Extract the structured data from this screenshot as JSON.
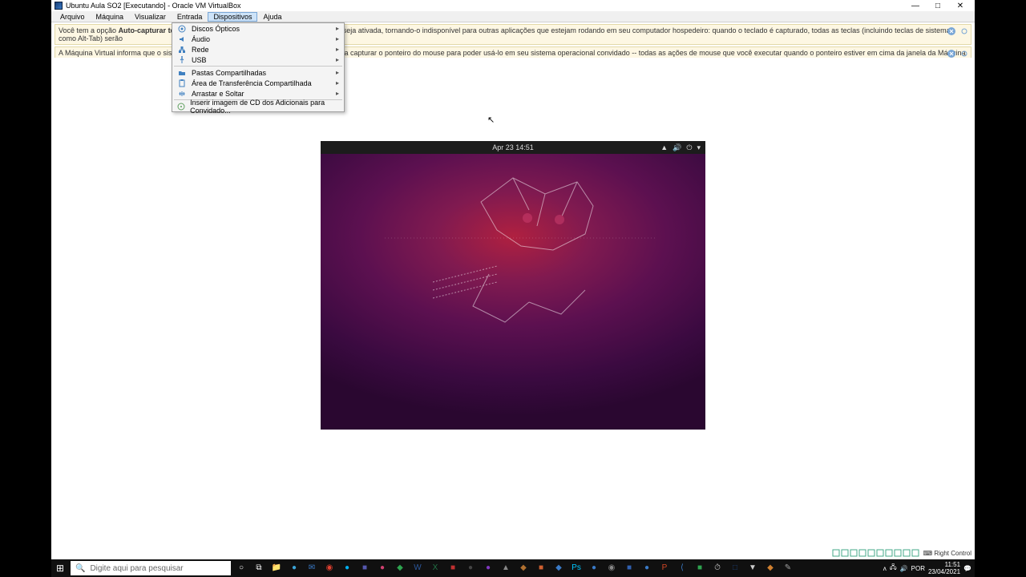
{
  "window": {
    "title": "Ubuntu Aula SO2 [Executando] - Oracle VM VirtualBox",
    "min": "—",
    "max": "□",
    "close": "✕"
  },
  "menubar": {
    "items": [
      "Arquivo",
      "Máquina",
      "Visualizar",
      "Entrada",
      "Dispositivos",
      "Ajuda"
    ],
    "active_index": 4
  },
  "info1": {
    "pre": "Você tem a opção ",
    "bold": "Auto-capturar teclado",
    "post": " ligada todas as vezes em que a janela da MV seja ativada, tornando-o indisponível para outras aplicações que estejam rodando em seu computador hospedeiro: quando o teclado é capturado, todas as teclas (incluindo teclas de sistema como Alt-Tab) serão"
  },
  "info2": {
    "text": "A Máquina Virtual informa que o sistema operacional … isto significa que você não precisa capturar o ponteiro do mouse para poder usá-lo em seu sistema operacional convidado -- todas as ações de mouse que você executar quando o ponteiro estiver em cima da janela da Máquina Virtual serão enviadas"
  },
  "dropdown": {
    "items": [
      {
        "icon": "disc-icon",
        "label": "Discos Ópticos",
        "sub": true
      },
      {
        "icon": "audio-icon",
        "label": "Áudio",
        "sub": true
      },
      {
        "icon": "network-icon",
        "label": "Rede",
        "sub": true
      },
      {
        "icon": "usb-icon",
        "label": "USB",
        "sub": true
      },
      {
        "sep": true
      },
      {
        "icon": "folder-icon",
        "label": "Pastas Compartilhadas",
        "sub": true
      },
      {
        "icon": "clipboard-icon",
        "label": "Área de Transferência Compartilhada",
        "sub": true
      },
      {
        "icon": "drag-icon",
        "label": "Arrastar e Soltar",
        "sub": true
      },
      {
        "sep": true
      },
      {
        "icon": "cd-insert-icon",
        "label": "Inserir imagem de CD dos Adicionais para Convidado...",
        "sub": false
      }
    ]
  },
  "ubuntu": {
    "datetime": "Apr 23  14:51"
  },
  "statusbar": {
    "host_key": "Right Control",
    "icons": [
      "hd",
      "disc",
      "audio",
      "net",
      "usb",
      "folder",
      "clip",
      "cam",
      "rec",
      "power"
    ]
  },
  "taskbar": {
    "search_placeholder": "Digite aqui para pesquisar",
    "apps": [
      {
        "name": "cortana",
        "glyph": "○",
        "color": "#fff"
      },
      {
        "name": "taskview",
        "glyph": "⧉",
        "color": "#fff"
      },
      {
        "name": "explorer",
        "glyph": "📁",
        "color": "#f6c050"
      },
      {
        "name": "edge",
        "glyph": "●",
        "color": "#3ba4d8"
      },
      {
        "name": "mail",
        "glyph": "✉",
        "color": "#3a7bc8"
      },
      {
        "name": "chrome",
        "glyph": "◉",
        "color": "#e04030"
      },
      {
        "name": "skype",
        "glyph": "●",
        "color": "#00aff0"
      },
      {
        "name": "teams",
        "glyph": "■",
        "color": "#5558af"
      },
      {
        "name": "app1",
        "glyph": "●",
        "color": "#d04070"
      },
      {
        "name": "app2",
        "glyph": "◆",
        "color": "#2ea44f"
      },
      {
        "name": "word",
        "glyph": "W",
        "color": "#2b579a"
      },
      {
        "name": "excel",
        "glyph": "X",
        "color": "#217346"
      },
      {
        "name": "app3",
        "glyph": "■",
        "color": "#c03030"
      },
      {
        "name": "app4",
        "glyph": "●",
        "color": "#444"
      },
      {
        "name": "app5",
        "glyph": "●",
        "color": "#8038c0"
      },
      {
        "name": "app6",
        "glyph": "▲",
        "color": "#888"
      },
      {
        "name": "app7",
        "glyph": "◆",
        "color": "#b07030"
      },
      {
        "name": "app8",
        "glyph": "■",
        "color": "#d06030"
      },
      {
        "name": "app9",
        "glyph": "◆",
        "color": "#3a7bc8"
      },
      {
        "name": "photoshop",
        "glyph": "Ps",
        "color": "#00c8ff"
      },
      {
        "name": "app10",
        "glyph": "●",
        "color": "#3a7bc8"
      },
      {
        "name": "obs",
        "glyph": "◉",
        "color": "#888"
      },
      {
        "name": "app11",
        "glyph": "■",
        "color": "#3060b0"
      },
      {
        "name": "app12",
        "glyph": "●",
        "color": "#3a7bc8"
      },
      {
        "name": "powerpoint",
        "glyph": "P",
        "color": "#d24726"
      },
      {
        "name": "vscode",
        "glyph": "⟨",
        "color": "#3a7bc8"
      },
      {
        "name": "app13",
        "glyph": "■",
        "color": "#2ea44f"
      },
      {
        "name": "app14",
        "glyph": "⏱",
        "color": "#ccc"
      },
      {
        "name": "virtualbox",
        "glyph": "□",
        "color": "#1a3e72"
      },
      {
        "name": "app15",
        "glyph": "▼",
        "color": "#ccc"
      },
      {
        "name": "app16",
        "glyph": "◆",
        "color": "#d08030"
      },
      {
        "name": "app17",
        "glyph": "✎",
        "color": "#a0a0a0"
      }
    ],
    "tray": {
      "up": "ᴧ",
      "net": "🖧",
      "vol": "🔊",
      "lang": "POR",
      "time": "11:51",
      "date": "23/04/2021"
    }
  }
}
